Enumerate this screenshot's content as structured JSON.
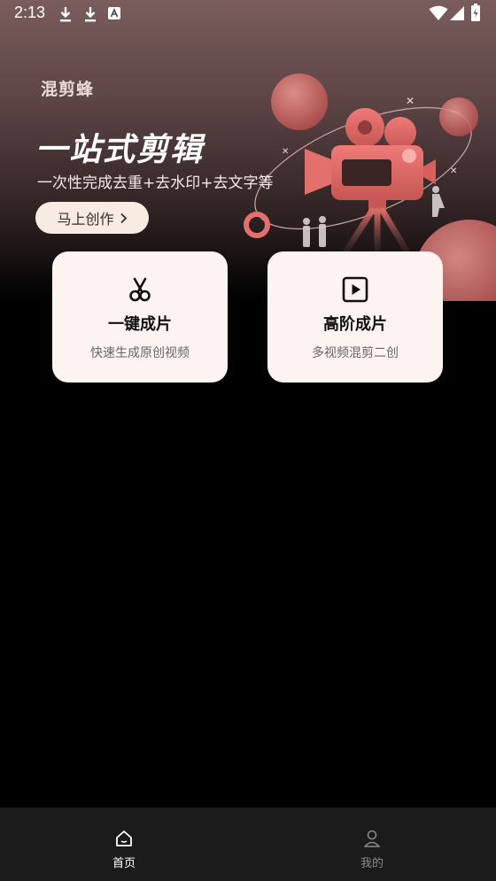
{
  "status_bar": {
    "time": "2:13",
    "icons": [
      "download-icon",
      "download-icon",
      "font-a-icon",
      "wifi-icon",
      "signal-icon",
      "battery-charging-icon"
    ]
  },
  "hero": {
    "brand": "混剪蜂",
    "title": "一站式剪辑",
    "subtitle": "一次性完成去重+去水印+去文字等",
    "cta_label": "马上创作",
    "cta_icon": "chevron-right-icon"
  },
  "cards": [
    {
      "icon": "scissors-icon",
      "title": "一键成片",
      "subtitle": "快速生成原创视频"
    },
    {
      "icon": "play-square-icon",
      "title": "高阶成片",
      "subtitle": "多视频混剪二创"
    }
  ],
  "bottom_nav": [
    {
      "icon": "home-icon",
      "label": "首页",
      "active": true
    },
    {
      "icon": "user-icon",
      "label": "我的",
      "active": false
    }
  ],
  "colors": {
    "accent": "#e8706e",
    "card_bg": "#fdf3f1",
    "nav_bg": "#1b1b1b"
  }
}
